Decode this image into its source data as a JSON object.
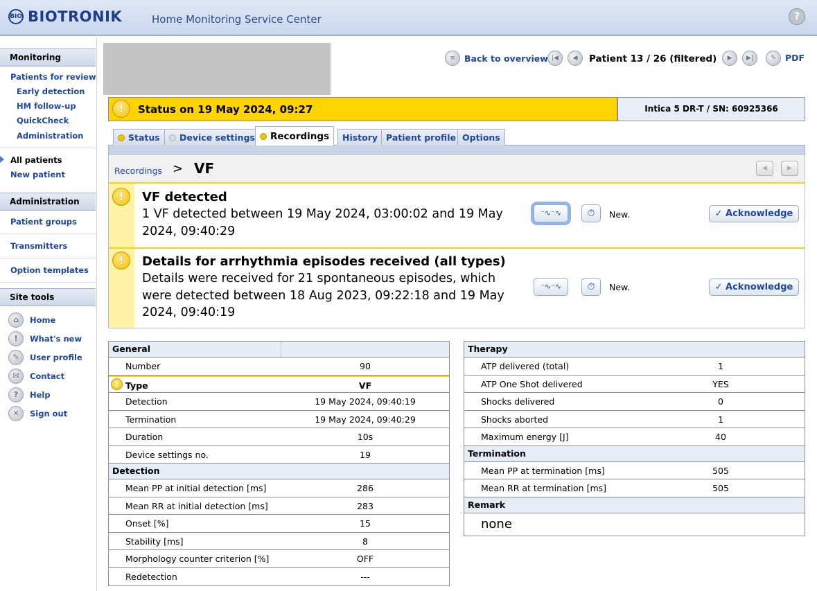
{
  "header": {
    "logo_text": "BIOTRONIK",
    "logo_mark": "BIO",
    "app_title": "Home Monitoring Service Center",
    "help_icon": "?"
  },
  "sidebar": {
    "monitoring_head": "Monitoring",
    "patients_for_review": "Patients for review",
    "early_detection": "Early detection",
    "hm_followup": "HM follow-up",
    "quickcheck": "QuickCheck",
    "administration_sub": "Administration",
    "all_patients": "All patients",
    "new_patient": "New patient",
    "administration_head": "Administration",
    "patient_groups": "Patient groups",
    "transmitters": "Transmitters",
    "option_templates": "Option templates",
    "site_tools_head": "Site tools",
    "tools": [
      {
        "label": "Home",
        "icon": "home-icon",
        "glyph": "⌂"
      },
      {
        "label": "What's new",
        "icon": "info-icon",
        "glyph": "!"
      },
      {
        "label": "User profile",
        "icon": "wrench-icon",
        "glyph": "✎"
      },
      {
        "label": "Contact",
        "icon": "mail-icon",
        "glyph": "✉"
      },
      {
        "label": "Help",
        "icon": "help-icon",
        "glyph": "?"
      },
      {
        "label": "Sign out",
        "icon": "signout-icon",
        "glyph": "✕"
      }
    ]
  },
  "topnav": {
    "back_label": "Back to overview",
    "patient_position": "Patient 13 / 26 (filtered)",
    "pdf_label": "PDF"
  },
  "status": {
    "text": "Status on 19 May 2024, 09:27",
    "device": "Intica 5 DR-T / SN: 60925366",
    "colors": {
      "status_bg": "#ffd400",
      "link": "#1f47a0"
    }
  },
  "tabs": [
    {
      "label": "Status",
      "dot": "#e8c800"
    },
    {
      "label": "Device settings",
      "dot": "#d8dde5"
    },
    {
      "label": "Recordings",
      "dot": "#e8c800"
    },
    {
      "label": "History"
    },
    {
      "label": "Patient profile"
    },
    {
      "label": "Options"
    }
  ],
  "breadcrumb": {
    "parent": "Recordings",
    "separator": ">",
    "current": "VF"
  },
  "messages": [
    {
      "title": "VF detected",
      "body": "1 VF detected between 19 May 2024, 03:00:02 and 19 May 2024, 09:40:29",
      "new_label": "New.",
      "ack_label": "✓ Acknowledge"
    },
    {
      "title": "Details for arrhythmia episodes received (all types)",
      "body": "Details were received for 21 spontaneous episodes, which were detected between 18 Aug 2023, 09:22:18 and 19 May 2024, 09:40:19",
      "new_label": "New.",
      "ack_label": "✓ Acknowledge"
    }
  ],
  "left_table": {
    "general_head": "General",
    "general_rows": [
      {
        "label": "Number",
        "value": "90"
      },
      {
        "label": "Type",
        "value": "VF"
      },
      {
        "label": "Detection",
        "value": "19 May 2024, 09:40:19"
      },
      {
        "label": "Termination",
        "value": "19 May 2024, 09:40:29"
      },
      {
        "label": "Duration",
        "value": "10s"
      },
      {
        "label": "Device settings no.",
        "value": "19"
      }
    ],
    "detection_head": "Detection",
    "detection_rows": [
      {
        "label": "Mean PP at initial detection [ms]",
        "value": "286"
      },
      {
        "label": "Mean RR at initial detection [ms]",
        "value": "283"
      },
      {
        "label": "Onset [%]",
        "value": "15"
      },
      {
        "label": "Stability [ms]",
        "value": "8"
      },
      {
        "label": "Morphology counter criterion [%]",
        "value": "OFF"
      },
      {
        "label": "Redetection",
        "value": "---"
      }
    ]
  },
  "right_table": {
    "therapy_head": "Therapy",
    "therapy_rows": [
      {
        "label": "ATP delivered (total)",
        "value": "1"
      },
      {
        "label": "ATP One Shot delivered",
        "value": "YES"
      },
      {
        "label": "Shocks delivered",
        "value": "0"
      },
      {
        "label": "Shocks aborted",
        "value": "1"
      },
      {
        "label": "Maximum energy [J]",
        "value": "40"
      }
    ],
    "termination_head": "Termination",
    "termination_rows": [
      {
        "label": "Mean PP at termination [ms]",
        "value": "505"
      },
      {
        "label": "Mean RR at termination [ms]",
        "value": "505"
      }
    ],
    "remark_head": "Remark",
    "remark_value": "none"
  }
}
